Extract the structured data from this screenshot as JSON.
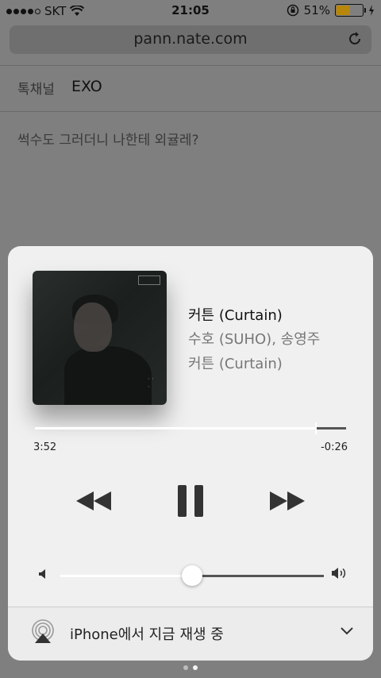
{
  "status": {
    "carrier": "SKT",
    "time": "21:05",
    "battery": "51%",
    "battery_level": 0.51
  },
  "browser": {
    "url": "pann.nate.com"
  },
  "page": {
    "channel_label": "톡채널",
    "channel_value": "EXO",
    "post_title": "썩수도 그러더니 나한테 외귤레?"
  },
  "player": {
    "title": "커튼 (Curtain)",
    "artist": "수호 (SUHO), 송영주",
    "album": "커튼 (Curtain)",
    "elapsed": "3:52",
    "remaining": "-0:26",
    "progress": 0.9,
    "volume": 0.5,
    "airplay_text": "iPhone에서 지금 재생 중"
  },
  "page_indicator": {
    "count": 2,
    "active": 2
  }
}
